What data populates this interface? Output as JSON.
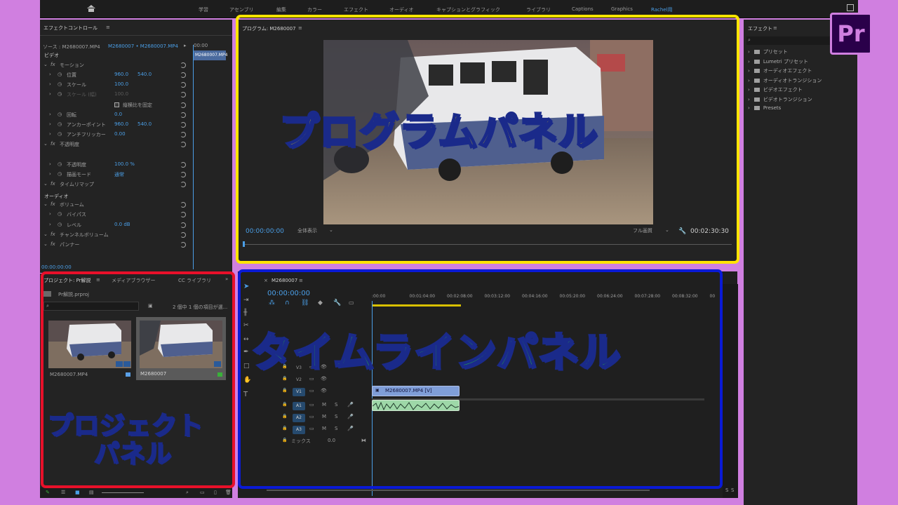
{
  "topbar": {
    "workspaces": [
      "学習",
      "アセンブリ",
      "編集",
      "カラー",
      "エフェクト",
      "オーディオ",
      "キャプションとグラフィック",
      "ライブラリ",
      "Captions",
      "Graphics",
      "Rachel用"
    ],
    "active_workspace": "Rachel用"
  },
  "effect_controls": {
    "title": "エフェクトコントロール",
    "source_label": "ソース : M2680007.MP4",
    "sequence_label": "M2680007 • M2680007.MP4",
    "time_marker": "00:00",
    "clip_label": "M2680007.MP4",
    "video_section": "ビデオ",
    "audio_section": "オーディオ",
    "rows": [
      {
        "label": "モーション",
        "fx": true
      },
      {
        "label": "位置",
        "v1": "960.0",
        "v2": "540.0"
      },
      {
        "label": "スケール",
        "v1": "100.0"
      },
      {
        "label": "スケール (幅)",
        "v1": "100.0",
        "dim": true
      },
      {
        "label": "縦横比を固定",
        "check": true
      },
      {
        "label": "回転",
        "v1": "0.0"
      },
      {
        "label": "アンカーポイント",
        "v1": "960.0",
        "v2": "540.0"
      },
      {
        "label": "アンチフリッカー",
        "v1": "0.00"
      },
      {
        "label": "不透明度",
        "fx": true
      },
      {
        "label": "不透明度",
        "v1": "100.0 %"
      },
      {
        "label": "描画モード",
        "v1": "通常"
      },
      {
        "label": "タイムリマップ",
        "fx": true
      },
      {
        "label": "ボリューム",
        "fx": true
      },
      {
        "label": "バイパス"
      },
      {
        "label": "レベル",
        "v1": "0.0 dB"
      },
      {
        "label": "チャンネルボリューム",
        "fx": true
      },
      {
        "label": "パンナー",
        "fx": true
      }
    ],
    "timecode": "00:00:00:00"
  },
  "program": {
    "title": "プログラム: M2680007",
    "timecode": "00:00:00:00",
    "zoom": "全体表示",
    "quality": "フル画質",
    "duration": "00:02:30:30"
  },
  "project": {
    "tabs": [
      "プロジェクト: Pr解説",
      "メディアブラウザー",
      "CC ライブラリ"
    ],
    "file": "Pr解説.prproj",
    "selection": "2 個中 1 個の項目が選...",
    "items": [
      "M2680007.MP4",
      "M2680007"
    ]
  },
  "timeline": {
    "sequence": "M2680007",
    "timecode": "00:00:00:00",
    "ruler": [
      ":00:00",
      "00:01:04:00",
      "00:02:08:00",
      "00:03:12:00",
      "00:04:16:00",
      "00:05:20:00",
      "00:06:24:00",
      "00:07:28:00",
      "00:08:32:00",
      "00"
    ],
    "video_tracks": [
      "V3",
      "V2",
      "V1"
    ],
    "audio_tracks": [
      "A1",
      "A2",
      "A3"
    ],
    "mix_label": "ミックス",
    "mix_value": "0.0",
    "clip_video": "M2680007.MP4 [V]",
    "audio_meter": [
      "S",
      "S"
    ]
  },
  "effects": {
    "title": "エフェクト",
    "items": [
      "プリセット",
      "Lumetri プリセット",
      "オーディオエフェクト",
      "オーディオトランジション",
      "ビデオエフェクト",
      "ビデオトランジション",
      "Presets"
    ]
  },
  "overlays": {
    "program": "プログラムパネル",
    "timeline": "タイムラインパネル",
    "project_line1": "プロジェクト",
    "project_line2": "パネル"
  },
  "logo": "Pr",
  "colors": {
    "program_box": "#ffe400",
    "project_box": "#e8102a",
    "timeline_box": "#0a1ad6",
    "timeline_text": "#2bd62b",
    "accent": "#4a9ee6"
  }
}
